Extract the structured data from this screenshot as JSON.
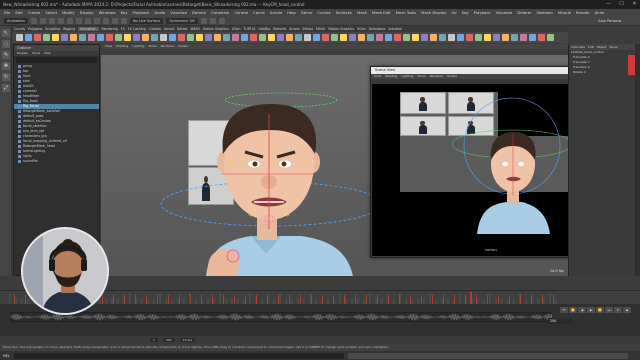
{
  "window": {
    "title": "New_Wireadvising 002.ma* - Autodesk MAYA 2024.2: D:\\Projects\\Facial Animation\\scenes\\Retarget\\Basic_Wireadvising 002.ma --- KeyCM_head_control",
    "minimize": "—",
    "maximize": "☐",
    "close": "✕"
  },
  "menubar": [
    "File",
    "Edit",
    "Create",
    "Select",
    "Modify",
    "Display",
    "Windows",
    "Key",
    "Playback",
    "Audio",
    "Visualize",
    "Deform",
    "Constrain",
    "Control",
    "Cache",
    "Arnold",
    "Help",
    "Gener",
    "Curves",
    "Surfaces",
    "Mesh",
    "Mesh Edit",
    "Mesh Tools",
    "Mesh Display",
    "UV",
    "Key",
    "Playback",
    "Visualize",
    "Deform",
    "Skeleton",
    "Muscle",
    "Render",
    "Anim"
  ],
  "statusline": {
    "mode": "Animation",
    "no_live": "No Live Surface",
    "symmetry": "Symmetry: Off",
    "user": "Alan Persona"
  },
  "shelf_tabs": [
    "Curves",
    "Polygons",
    "Sculpting",
    "Rigging",
    "Animation",
    "Rendering",
    "FX",
    "FX Caching",
    "Custom",
    "Arnold",
    "Bifrost",
    "MASH",
    "Motion Graphics",
    "XGen",
    "TURTLE",
    "Hat/Bip",
    "Redshift",
    "Arnold",
    "Bifrost",
    "MASH",
    "Motion Graphics",
    "XGen",
    "Anim/bezz",
    "Animbot"
  ],
  "outliner": {
    "title": "Outliner",
    "menu": [
      "Display",
      "Show",
      "Help"
    ],
    "items": [
      "persp",
      "top",
      "front",
      "side",
      "shot01",
      "camera1",
      "headMesh",
      "Rig_Basic",
      "Rig_Facial",
      "RetargetMesh_bsDeforl",
      "default_pose",
      "default_bsControl",
      "facial_skeleton",
      "eye_dnm_std",
      "characters_grp",
      "facial_mapping_ctrlbnet_ctl",
      "RetargetMesh_head",
      "sceneLighting",
      "lights",
      "soundfile"
    ],
    "selected_index": 8
  },
  "viewport": {
    "panel_menu": [
      "View",
      "Shading",
      "Lighting",
      "Show",
      "Renderer",
      "Panels"
    ],
    "fps": "24.0 fps"
  },
  "scene_view": {
    "title": "Scene View",
    "menu": [
      "View",
      "Shading",
      "Lighting",
      "Show",
      "Renderer",
      "Panels"
    ],
    "camera_label": "SHOT01",
    "fps": "24.0 fps"
  },
  "channel_box": {
    "tabs": [
      "Channels",
      "Edit",
      "Object",
      "Show"
    ],
    "object": "kmlhAD_head_control",
    "channels": [
      {
        "name": "Translate X",
        "value": "0"
      },
      {
        "name": "Translate Y",
        "value": "0"
      },
      {
        "name": "Translate Z",
        "value": "0"
      },
      {
        "name": "Rotate X",
        "value": "0"
      }
    ]
  },
  "timeline": {
    "current_frame": "290",
    "start_field": "1",
    "end_field": "465",
    "fps_label": "24 fps"
  },
  "helpline": "Move Tool: Use manipulator to move object(s). Shift+drag manipulator axis or plane handle to extrude components or clone objects. Ctrl+LMB+drag to constrain movement to connected edges. Use D or INSERT to change pivot position and axis orientation.",
  "cmdline": {
    "mel": "MEL"
  },
  "colors": {
    "selection": "#5285a6",
    "keyed_channel": "#d0393d",
    "viewport_bg": "#5d5d5d"
  }
}
